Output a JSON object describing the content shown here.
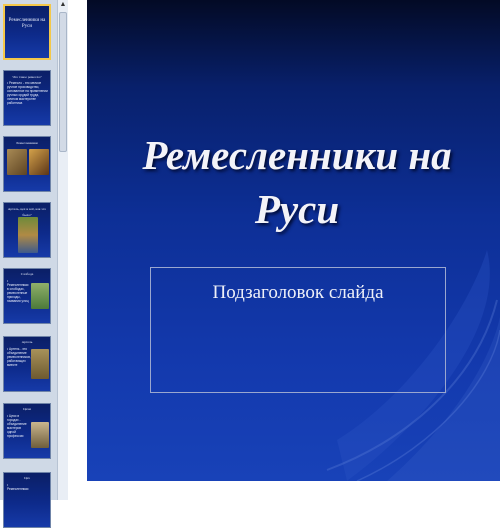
{
  "slide": {
    "title": "Ремесленники на Руси",
    "subtitle": "Подзаголовок слайда"
  },
  "thumbnails": [
    {
      "title": "Ремесленники на Руси"
    },
    {
      "title": "Что такое ремесло?",
      "text": "• Ремесло - это мелкое ручное производство, основанное на применении ручных орудий труда, личном мастерстве работника"
    },
    {
      "title": "Ремесленники"
    },
    {
      "title": "Артель, цех и всё, как это было?"
    },
    {
      "title": "Слобода",
      "text": "• Ремесленники в слободах, ремесленные приходы, названия улиц"
    },
    {
      "title": "Артель",
      "text": "• Артель - это объединение ремесленников, работающих вместе"
    },
    {
      "title": "Цехи",
      "text": "• Цехи в городах - объединение мастеров одной профессии"
    },
    {
      "title": "Цех",
      "text": "• Ремесленники"
    }
  ],
  "colors": {
    "slide_background": "#0d2f96",
    "selected_border": "#f4c84a"
  }
}
